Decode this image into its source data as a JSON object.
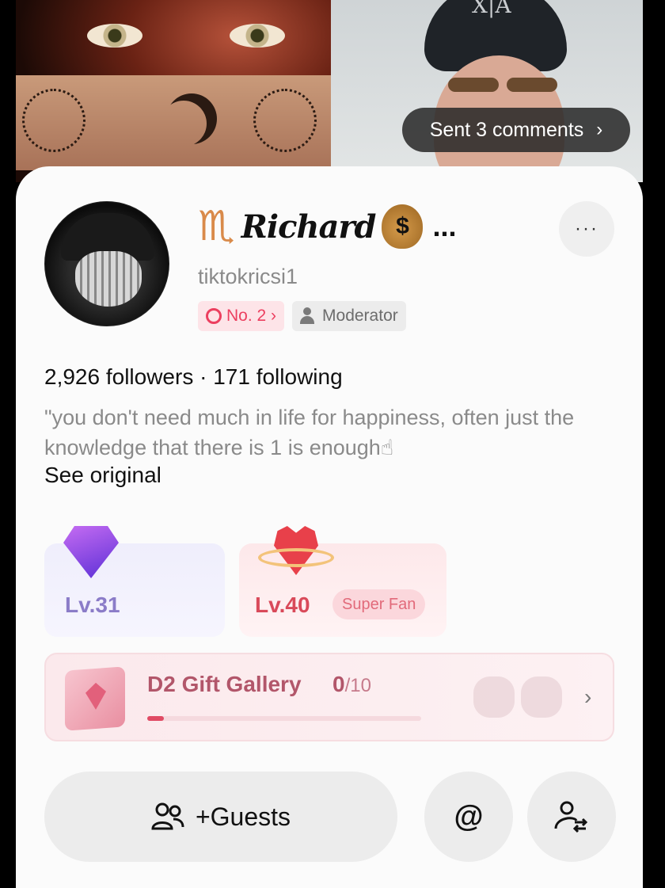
{
  "live": {
    "comments_pill": "Sent 3 comments",
    "cap_logo": "X|A"
  },
  "profile": {
    "display_name": "Richard",
    "name_emoji_left": "♏",
    "name_emoji_right": "$",
    "name_truncation": "...",
    "username": "tiktokricsi1",
    "rank_badge": "No. 2 ›",
    "role_badge": "Moderator",
    "stats": "2,926 followers · 171 following",
    "bio": "\"you don't need much in life for happiness, often just the knowledge that there is 1 is enough☝",
    "see_original": "See original"
  },
  "levels": {
    "gem_level": "Lv.31",
    "fan_level": "Lv.40",
    "fan_tag": "Super Fan"
  },
  "gift_gallery": {
    "title": "D2 Gift Gallery",
    "collected": "0",
    "total": "/10",
    "progress_fraction": 0.06,
    "chevron": "›"
  },
  "actions": {
    "guests_label": "+Guests",
    "mention_icon": "@",
    "more_icon": "···"
  },
  "colors": {
    "rank_red": "#ec3f5f",
    "gem_purple": "#8b7cc8",
    "fan_red": "#d94a5a",
    "gallery_text": "#b2566a"
  }
}
